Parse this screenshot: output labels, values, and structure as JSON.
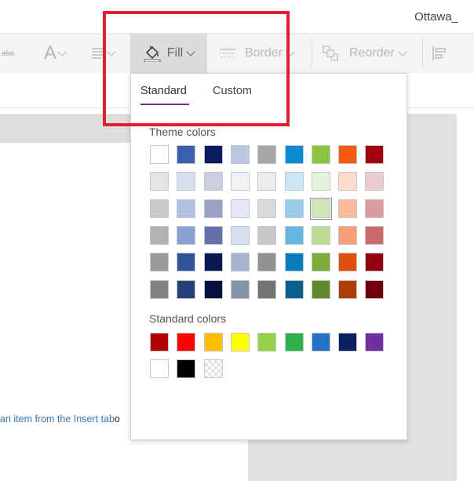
{
  "header": {
    "user_name": "Ottawa_"
  },
  "ribbon": {
    "strikethrough_label": "abc",
    "font_size_label": "A",
    "fill_label": "Fill",
    "border_label": "Border",
    "reorder_label": "Reorder"
  },
  "fill_dropdown": {
    "tabs": [
      {
        "label": "Standard",
        "active": true
      },
      {
        "label": "Custom",
        "active": false
      }
    ],
    "theme_colors_label": "Theme colors",
    "theme_colors": [
      [
        "#ffffff",
        "#3a5fad",
        "#0d1a64",
        "#b8c8e2",
        "#a6a6a6",
        "#0a8ad4",
        "#8ac440",
        "#f85a10",
        "#a40010"
      ],
      [
        "#e5e5e5",
        "#d7def0",
        "#cccfe1",
        "#eef3f8",
        "#ececec",
        "#cce6f5",
        "#e7f2da",
        "#fddccd",
        "#ecccce"
      ],
      [
        "#cacaca",
        "#b0c0e2",
        "#9aa2c8",
        "#e2e9f3",
        "#dadada",
        "#97cdec",
        "#d2e6b8",
        "#fbbb9d",
        "#dc9a9e"
      ],
      [
        "#b2b2b2",
        "#8aa0d4",
        "#6670ad",
        "#d6e0ee",
        "#c8c8c8",
        "#66b6e5",
        "#badd91",
        "#f8a079",
        "#cc676c"
      ],
      [
        "#9a9a9a",
        "#325397",
        "#0a164f",
        "#a6b5cf",
        "#929292",
        "#097cbe",
        "#7bab38",
        "#df4f0e",
        "#910010"
      ],
      [
        "#828282",
        "#25417a",
        "#07103c",
        "#8693aa",
        "#747474",
        "#086090",
        "#5e8a2a",
        "#ad3e0a",
        "#700010"
      ]
    ],
    "selected_theme_color": "#d2e6b8",
    "standard_colors_label": "Standard colors",
    "standard_colors": [
      [
        "#b00000",
        "#ff0000",
        "#ffbe00",
        "#ffff00",
        "#96d046",
        "#2fb04e",
        "#2472c6",
        "#0c1f60",
        "#7030a0"
      ],
      [
        "#ffffff",
        "#000000",
        "transparent"
      ]
    ]
  },
  "canvas": {
    "hint_text": "an item from the Insert tab",
    "hint_tail": "o"
  },
  "colors": {
    "accent": "#7b2e84",
    "annotation": "#e0202e",
    "ribbon_bg": "#f4f4f4"
  }
}
